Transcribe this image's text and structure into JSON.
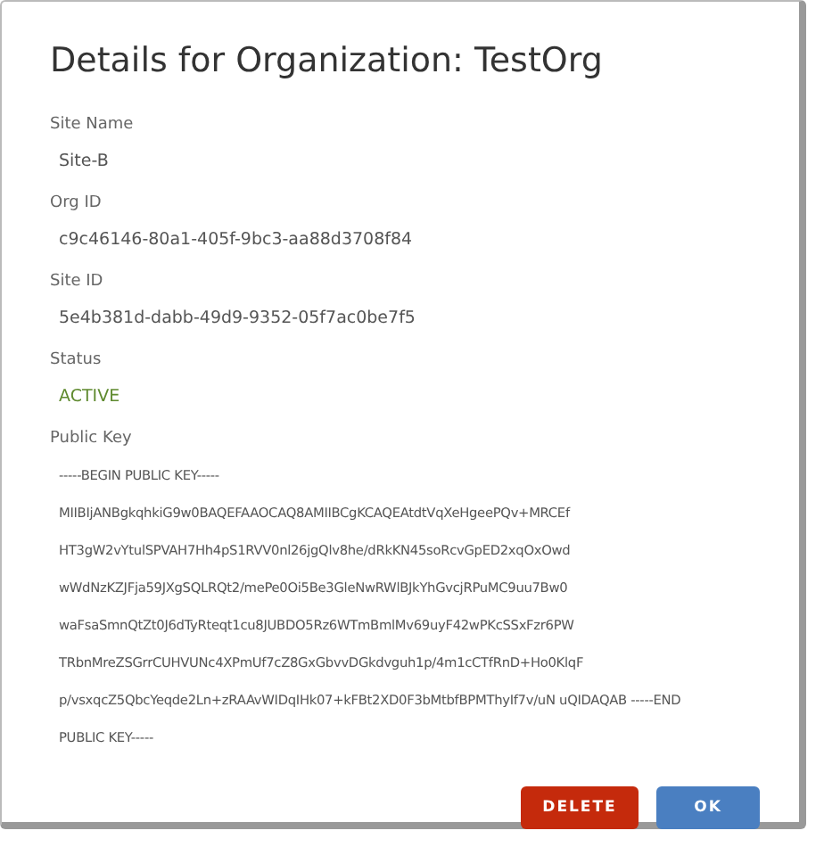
{
  "dialog": {
    "title": "Details for Organization: TestOrg",
    "fields": [
      {
        "label": "Site Name",
        "value": "Site-B",
        "kind": "plain"
      },
      {
        "label": "Org ID",
        "value": "c9c46146-80a1-405f-9bc3-aa88d3708f84",
        "kind": "plain"
      },
      {
        "label": "Site ID",
        "value": "5e4b381d-dabb-49d9-9352-05f7ac0be7f5",
        "kind": "plain"
      },
      {
        "label": "Status",
        "value": "ACTIVE",
        "kind": "success"
      },
      {
        "label": "Public Key",
        "kind": "lines",
        "lines": [
          "-----BEGIN PUBLIC KEY-----",
          "MIIBIjANBgkqhkiG9w0BAQEFAAOCAQ8AMIIBCgKCAQEAtdtVqXeHgeePQv+MRCEf",
          "HT3gW2vYtulSPVAH7Hh4pS1RVV0nl26jgQlv8he/dRkKN45soRcvGpED2xqOxOwd",
          "wWdNzKZJFja59JXgSQLRQt2/mePe0Oi5Be3GleNwRWlBJkYhGvcjRPuMC9uu7Bw0",
          "waFsaSmnQtZt0J6dTyRteqt1cu8JUBDO5Rz6WTmBmlMv69uyF42wPKcSSxFzr6PW",
          "TRbnMreZSGrrCUHVUNc4XPmUf7cZ8GxGbvvDGkdvguh1p/4m1cCTfRnD+Ho0KlqF",
          "p/vsxqcZ5QbcYeqde2Ln+zRAAvWIDqIHk07+kFBt2XD0F3bMtbfBPMThyIf7v/uN uQIDAQAB -----END",
          "PUBLIC KEY-----"
        ]
      }
    ],
    "buttons": [
      {
        "label": "DELETE",
        "kind": "danger"
      },
      {
        "label": "OK",
        "kind": "primary"
      }
    ]
  }
}
